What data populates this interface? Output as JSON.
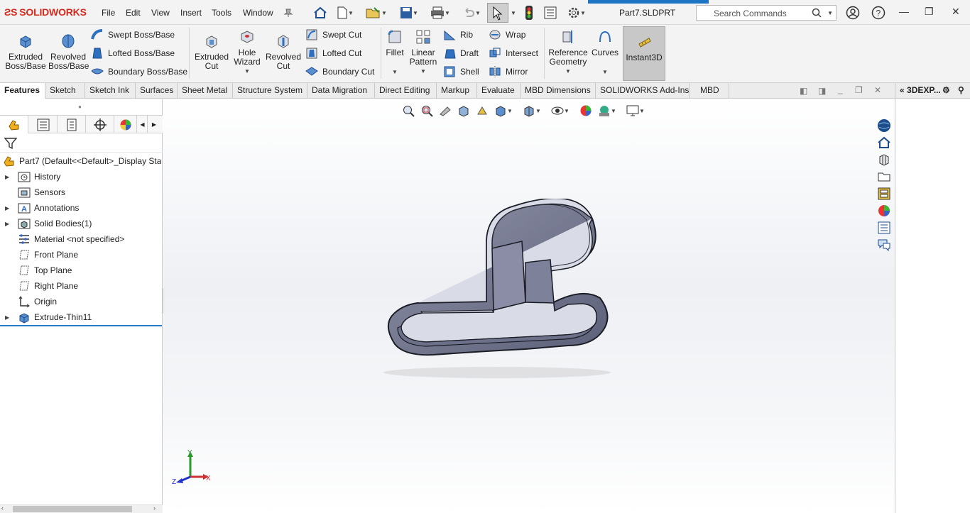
{
  "app": {
    "brand": "SOLIDWORKS",
    "document_title": "Part7.SLDPRT",
    "accent": "#d52b1e"
  },
  "menu": [
    "File",
    "Edit",
    "View",
    "Insert",
    "Tools",
    "Window"
  ],
  "search": {
    "placeholder": "Search Commands"
  },
  "ribbon": {
    "extruded_boss": "Extruded\nBoss/Base",
    "revolved_boss": "Revolved\nBoss/Base",
    "swept_boss": "Swept Boss/Base",
    "lofted_boss": "Lofted Boss/Base",
    "boundary_boss": "Boundary Boss/Base",
    "extruded_cut": "Extruded\nCut",
    "hole_wizard": "Hole\nWizard",
    "revolved_cut": "Revolved\nCut",
    "swept_cut": "Swept Cut",
    "lofted_cut": "Lofted Cut",
    "boundary_cut": "Boundary Cut",
    "fillet": "Fillet",
    "linear_pattern": "Linear\nPattern",
    "rib": "Rib",
    "draft": "Draft",
    "shell": "Shell",
    "wrap": "Wrap",
    "intersect": "Intersect",
    "mirror": "Mirror",
    "reference_geometry": "Reference\nGeometry",
    "curves": "Curves",
    "instant3d": "Instant3D"
  },
  "tabs": [
    "Features",
    "Sketch",
    "Sketch Ink",
    "Surfaces",
    "Sheet Metal",
    "Structure System",
    "Data Migration",
    "Direct Editing",
    "Markup",
    "Evaluate",
    "MBD Dimensions",
    "SOLIDWORKS Add-Ins",
    "MBD"
  ],
  "task_pane": {
    "title": "3DEXP..."
  },
  "tree": {
    "root": "Part7  (Default<<Default>_Display Sta",
    "items": [
      {
        "label": "History",
        "expandable": true
      },
      {
        "label": "Sensors",
        "expandable": false
      },
      {
        "label": "Annotations",
        "expandable": true
      },
      {
        "label": "Solid Bodies(1)",
        "expandable": true
      },
      {
        "label": "Material <not specified>",
        "expandable": false
      },
      {
        "label": "Front Plane",
        "expandable": false
      },
      {
        "label": "Top Plane",
        "expandable": false
      },
      {
        "label": "Right Plane",
        "expandable": false
      },
      {
        "label": "Origin",
        "expandable": false
      },
      {
        "label": "Extrude-Thin11",
        "expandable": true
      }
    ]
  },
  "triad": {
    "x": "X",
    "y": "Y",
    "z": "Z"
  }
}
